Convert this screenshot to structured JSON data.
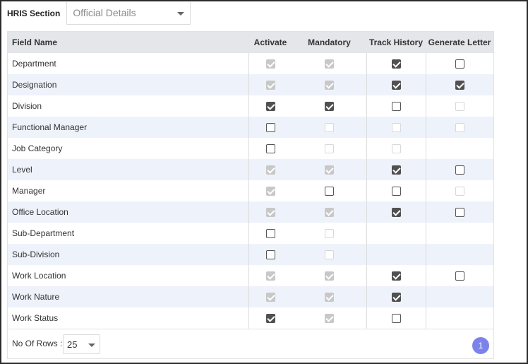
{
  "header": {
    "section_label": "HRIS Section",
    "section_value": "Official Details"
  },
  "columns": [
    "Field Name",
    "Activate",
    "Mandatory",
    "Track History",
    "Generate Letter"
  ],
  "rows": [
    {
      "name": "Department",
      "cells": [
        "on-dis",
        "on-dis",
        "on",
        "off"
      ]
    },
    {
      "name": "Designation",
      "cells": [
        "on-dis",
        "on-dis",
        "on",
        "on"
      ]
    },
    {
      "name": "Division",
      "cells": [
        "on",
        "on",
        "off",
        "off-dis"
      ]
    },
    {
      "name": "Functional Manager",
      "cells": [
        "off",
        "off-dis",
        "off-dis",
        "off-dis"
      ]
    },
    {
      "name": "Job Category",
      "cells": [
        "off",
        "off-dis",
        "off-dis",
        "none"
      ]
    },
    {
      "name": "Level",
      "cells": [
        "on-dis",
        "on-dis",
        "on",
        "off"
      ]
    },
    {
      "name": "Manager",
      "cells": [
        "on-dis",
        "off",
        "off",
        "off-dis"
      ]
    },
    {
      "name": "Office Location",
      "cells": [
        "on-dis",
        "on-dis",
        "on",
        "off"
      ]
    },
    {
      "name": "Sub-Department",
      "cells": [
        "off",
        "off-dis",
        "none",
        "none"
      ]
    },
    {
      "name": "Sub-Division",
      "cells": [
        "off",
        "off-dis",
        "none",
        "none"
      ]
    },
    {
      "name": "Work Location",
      "cells": [
        "on-dis",
        "on-dis",
        "on",
        "off"
      ]
    },
    {
      "name": "Work Nature",
      "cells": [
        "on-dis",
        "on-dis",
        "on",
        "none"
      ]
    },
    {
      "name": "Work Status",
      "cells": [
        "on",
        "on-dis",
        "off",
        "none"
      ]
    }
  ],
  "footer": {
    "rows_label": "No Of Rows :",
    "rows_value": "25",
    "page": "1"
  },
  "colors": {
    "header_bg": "#e4e6ea",
    "alt_row_bg": "#eef2fa",
    "page_button": "#7b83eb",
    "checked": "#505050",
    "checked_disabled": "#c8c8c8"
  },
  "icons": {
    "dropdown": "chevron-down-icon",
    "checkbox": "checkbox-icon"
  }
}
